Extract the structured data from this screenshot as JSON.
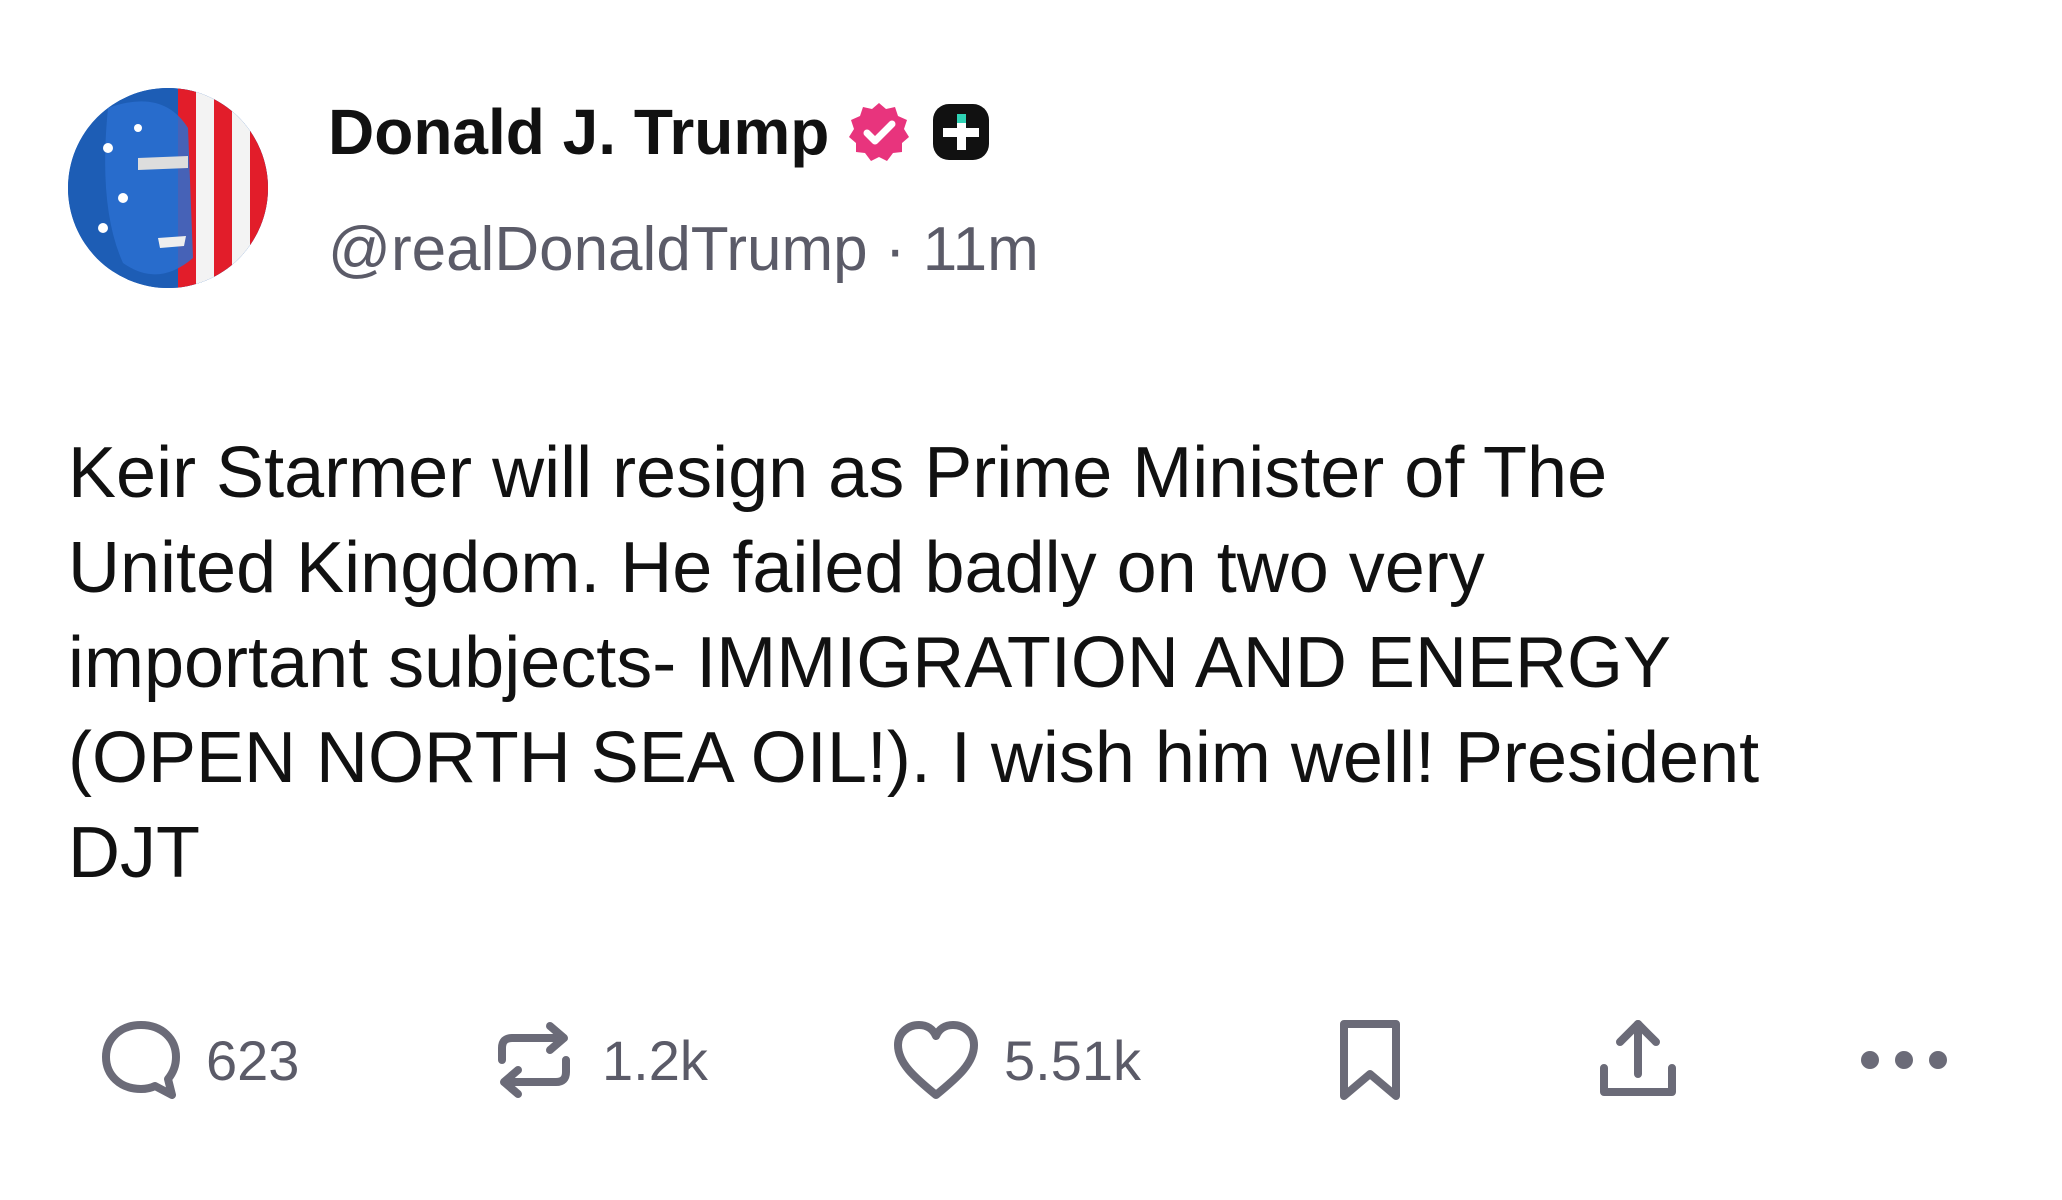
{
  "author": {
    "display_name": "Donald J. Trump",
    "handle": "@realDonaldTrump",
    "separator": "·",
    "time_ago": "11m",
    "verified_badge_icon": "verified-check-icon",
    "subscription_badge_icon": "plus-icon"
  },
  "post": {
    "text": "Keir Starmer will resign as Prime Minister of The\nUnited Kingdom. He failed badly on two very\nimportant subjects- IMMIGRATION AND ENERGY\n(OPEN NORTH SEA OIL!). I wish him well! President\nDJT"
  },
  "actions": {
    "reply": {
      "icon": "comment-icon",
      "count": "623"
    },
    "repost": {
      "icon": "repost-icon",
      "count": "1.2k"
    },
    "like": {
      "icon": "heart-icon",
      "count": "5.51k"
    },
    "bookmark": {
      "icon": "bookmark-icon"
    },
    "share": {
      "icon": "share-icon"
    },
    "more": {
      "icon": "more-dots-icon"
    }
  },
  "colors": {
    "text": "#111111",
    "muted": "#5b5b68",
    "verified_pink": "#e8347d",
    "icon_gray": "#6b6b78"
  }
}
